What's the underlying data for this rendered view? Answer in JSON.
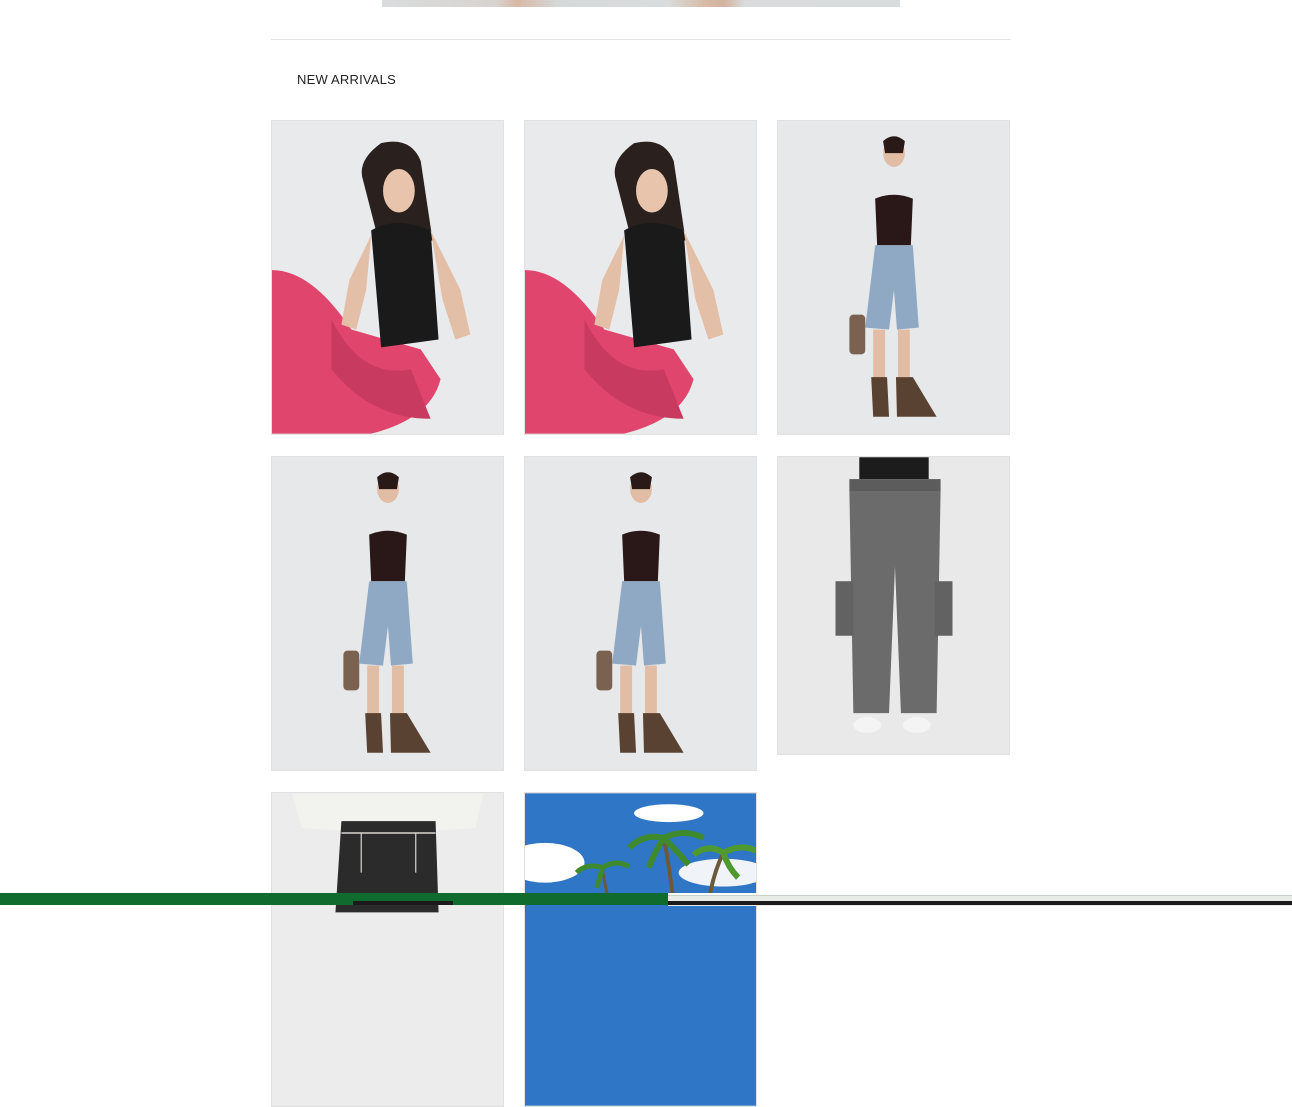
{
  "section": {
    "title": "NEW ARRIVALS"
  },
  "products": [
    {
      "name": "black-zip-tank-pink-pants-sitting-photo",
      "colors": {
        "bg": "#e9eaec",
        "top": "#1a1a1a",
        "bottom": "#e0456e"
      }
    },
    {
      "name": "black-zip-tank-pink-pants-sitting-photo-2",
      "colors": {
        "bg": "#e9eaec",
        "top": "#1a1a1a",
        "bottom": "#e0456e"
      }
    },
    {
      "name": "halter-top-denim-shorts-photo",
      "colors": {
        "bg": "#e7e8ea",
        "top": "#2a1717",
        "bottom": "#8fa9c4"
      }
    },
    {
      "name": "halter-top-denim-shorts-photo-2",
      "colors": {
        "bg": "#e7e8ea",
        "top": "#2a1717",
        "bottom": "#8fa9c4"
      }
    },
    {
      "name": "halter-top-denim-shorts-photo-3",
      "colors": {
        "bg": "#e7e8ea",
        "top": "#2a1717",
        "bottom": "#8fa9c4"
      }
    },
    {
      "name": "gray-cargo-pants-photo",
      "colors": {
        "bg": "#e9e9ea",
        "top": "#1c1c1c",
        "bottom": "#6b6b6b"
      }
    },
    {
      "name": "black-jeans-knit-top-photo",
      "colors": {
        "bg": "#ececec",
        "top": "#f2f2ef",
        "bottom": "#2b2b2b"
      }
    },
    {
      "name": "palm-trees-sky-photo",
      "colors": {
        "bg": "#2f76c6",
        "top": "#ffffff",
        "bottom": "#3f8a2c"
      }
    }
  ],
  "scroll_progress": 0.517
}
